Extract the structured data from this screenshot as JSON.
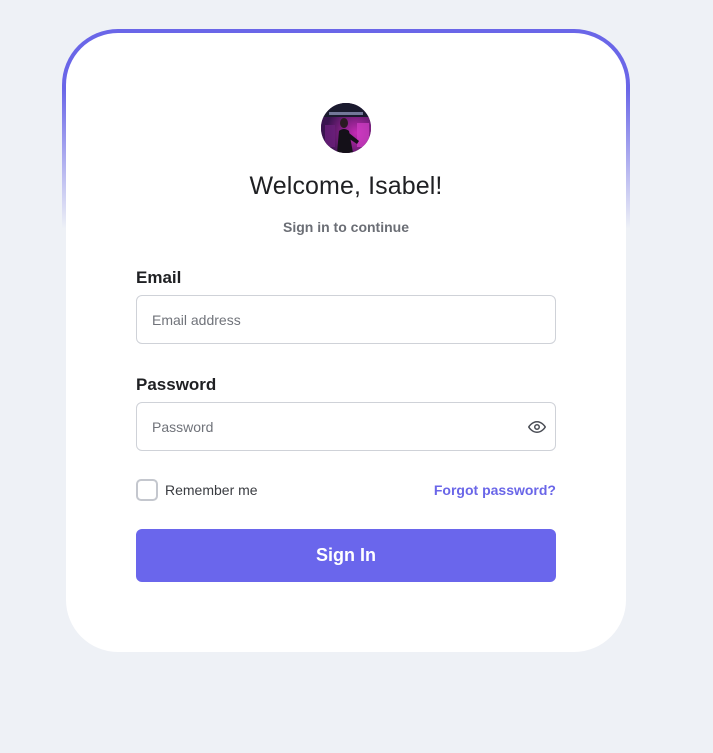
{
  "greeting": {
    "title": "Welcome, Isabel!",
    "subtitle": "Sign in to continue"
  },
  "form": {
    "email": {
      "label": "Email",
      "placeholder": "Email address",
      "value": ""
    },
    "password": {
      "label": "Password",
      "placeholder": "Password",
      "value": "",
      "toggle_icon": "eye-icon"
    },
    "remember": {
      "label": "Remember me",
      "checked": false
    },
    "forgot_label": "Forgot password?",
    "submit_label": "Sign In"
  },
  "colors": {
    "accent": "#6a66ec",
    "background": "#eef1f6",
    "card": "#ffffff"
  }
}
